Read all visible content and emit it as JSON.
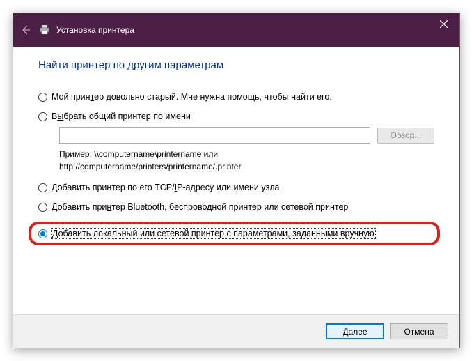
{
  "titlebar": {
    "title": "Установка принтера"
  },
  "heading": "Найти принтер по другим параметрам",
  "options": {
    "old": {
      "pre": "Мой прин",
      "u": "т",
      "post": "ер довольно старый. Мне нужна помощь, чтобы найти его."
    },
    "byname": {
      "pre": "В",
      "u": "ы",
      "post": "брать общий принтер по имени"
    },
    "example_l1": "Пример: \\\\computername\\printername или",
    "example_l2": "http://computername/printers/printername/.printer",
    "tcp": {
      "pre": "Добавить принтер по его TCP/",
      "u": "I",
      "post": "P-адресу или имени узла"
    },
    "bt": {
      "pre": "Добавить при",
      "u": "н",
      "post": "тер Bluetooth, беспроводной принтер или сетевой принтер"
    },
    "manual": "Добавить локальный или сетевой принтер с параметрами, заданными вручную"
  },
  "buttons": {
    "browse": "Обзор...",
    "next_pre": "",
    "next_u": "Д",
    "next_post": "алее",
    "cancel": "Отмена"
  }
}
